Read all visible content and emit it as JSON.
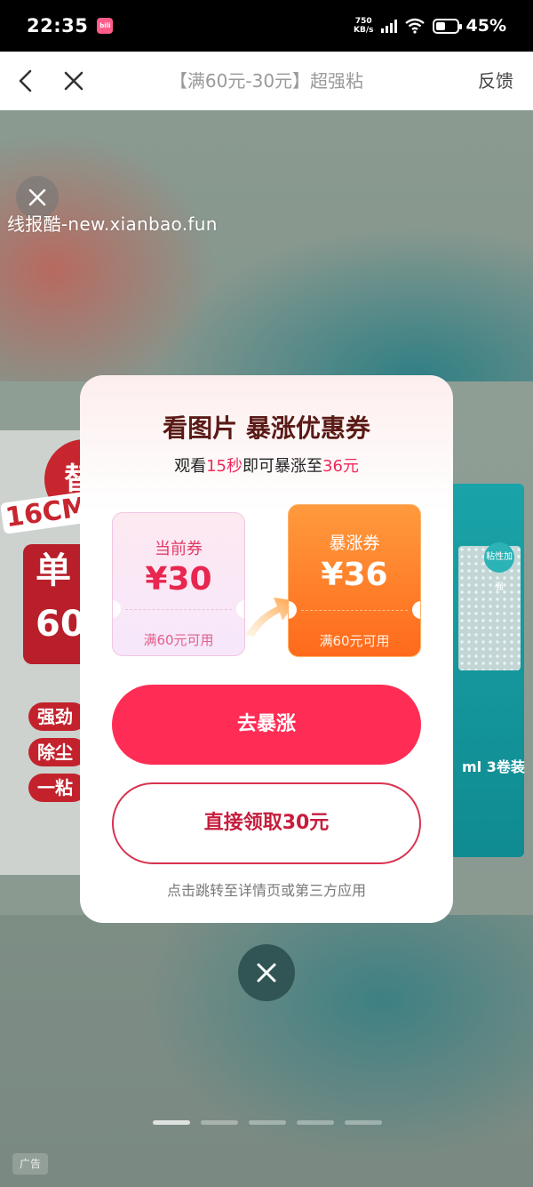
{
  "status_bar": {
    "time": "22:35",
    "app_badge": "bilibili",
    "net_speed_value": "750",
    "net_speed_unit": "KB/s",
    "battery_percent": "45%",
    "battery_level": 0.45
  },
  "nav": {
    "title": "【满60元-30元】超强粘",
    "feedback": "反馈"
  },
  "background": {
    "watermark": "线报酷-new.xianbao.fun",
    "product_text": {
      "badge": "替",
      "size_tag": "16CM",
      "panel_line1": "单",
      "panel_line2": "60",
      "pill1": "强劲",
      "pill2": "除尘",
      "pill3": "一粘",
      "right_label": "ml 3卷装",
      "right_icon_text": "粘性加强"
    },
    "ad_badge": "广告"
  },
  "modal": {
    "title": "看图片 暴涨优惠券",
    "subtitle_prefix": "观看",
    "subtitle_seconds": "15秒",
    "subtitle_middle": "即可暴涨至",
    "subtitle_amount": "36元",
    "coupon_current": {
      "label": "当前券",
      "amount": "¥30",
      "condition": "满60元可用"
    },
    "coupon_boost": {
      "label": "暴涨券",
      "amount": "¥36",
      "condition": "满60元可用"
    },
    "boost_button": "去暴涨",
    "claim_button": "直接领取30元",
    "footnote": "点击跳转至详情页或第三方应用"
  },
  "pager": {
    "count": 5,
    "active_index": 0
  },
  "colors": {
    "primary": "#ff2d55",
    "boost_orange": "#ff6a1c",
    "title_brown": "#5a1a16",
    "highlight": "#f0295a"
  },
  "icons": {
    "nav_back": "chevron-left-icon",
    "nav_close": "close-icon",
    "modal_close": "close-icon",
    "arrow": "curved-arrow-icon"
  }
}
